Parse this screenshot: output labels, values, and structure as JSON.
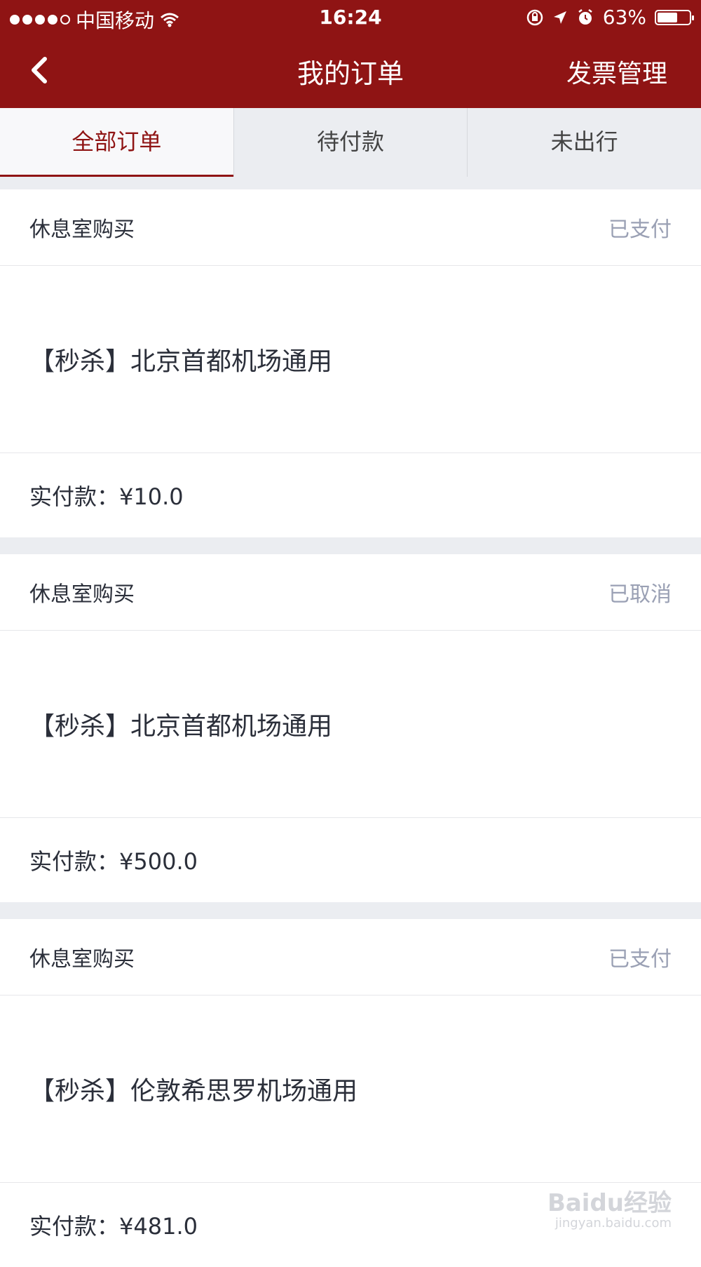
{
  "status_bar": {
    "carrier": "中国移动",
    "time": "16:24",
    "battery": "63%",
    "battery_level": 0.63,
    "icons": [
      "signal-dots-icon",
      "wifi-icon",
      "orientation-lock-icon",
      "location-icon",
      "alarm-icon",
      "battery-icon"
    ]
  },
  "header": {
    "title": "我的订单",
    "invoice_label": "发票管理",
    "back_icon": "chevron-left-icon"
  },
  "tabs": [
    {
      "label": "全部订单",
      "active": true
    },
    {
      "label": "待付款",
      "active": false
    },
    {
      "label": "未出行",
      "active": false
    }
  ],
  "orders": [
    {
      "type": "休息室购买",
      "status": "已支付",
      "product": "【秒杀】北京首都机场通用",
      "paid": "实付款：¥10.0"
    },
    {
      "type": "休息室购买",
      "status": "已取消",
      "product": "【秒杀】北京首都机场通用",
      "paid": "实付款：¥500.0"
    },
    {
      "type": "休息室购买",
      "status": "已支付",
      "product": "【秒杀】伦敦希思罗机场通用",
      "paid": "实付款：¥481.0"
    }
  ],
  "watermark": {
    "main": "Baidu经验",
    "sub": "jingyan.baidu.com"
  },
  "colors": {
    "brand": "#8f1414",
    "status_text": "#9aa0b4",
    "background": "#ebedf1"
  }
}
